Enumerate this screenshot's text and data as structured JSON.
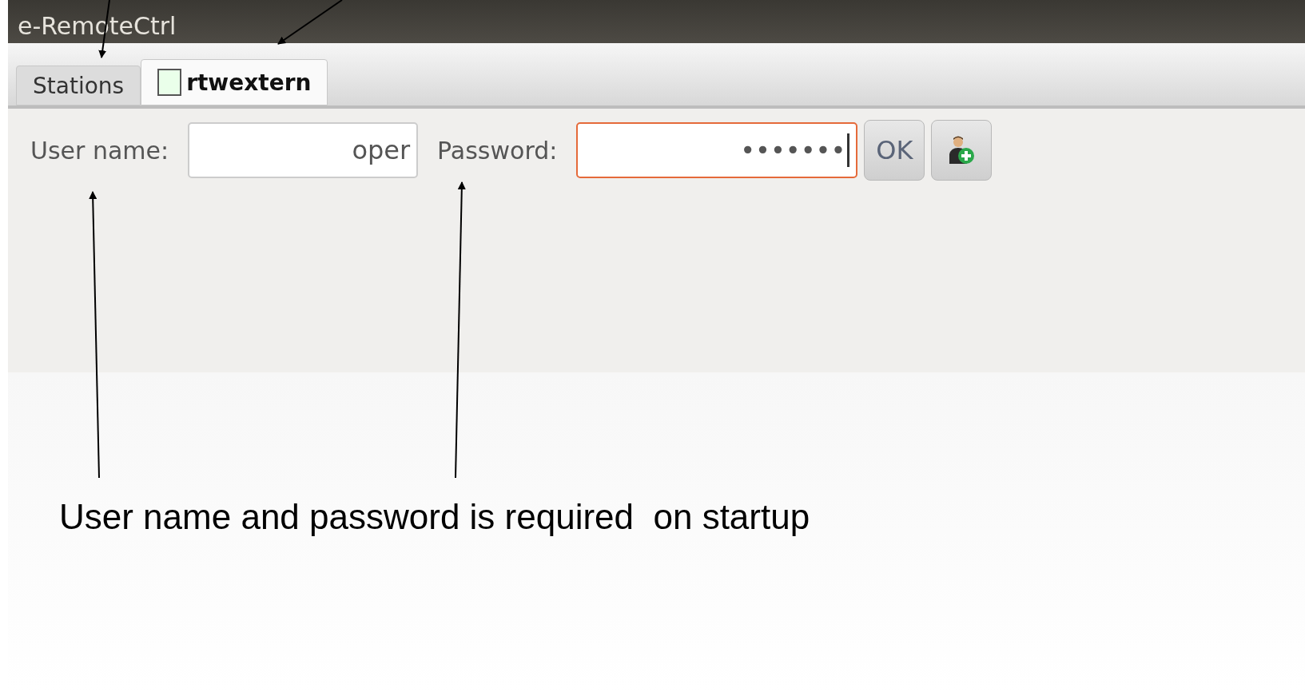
{
  "window": {
    "title": "e-RemoteCtrl"
  },
  "tabs": [
    {
      "label": "Stations",
      "selected": false,
      "has_status_box": false
    },
    {
      "label": "rtwextern",
      "selected": true,
      "has_status_box": true
    }
  ],
  "login": {
    "fields": [
      {
        "label": "User name:",
        "value": "oper",
        "focused": false
      },
      {
        "label": "Password:",
        "value": "•••••••",
        "focused": true
      }
    ],
    "ok_button": "OK"
  },
  "caption": "User name and password is required  on startup"
}
